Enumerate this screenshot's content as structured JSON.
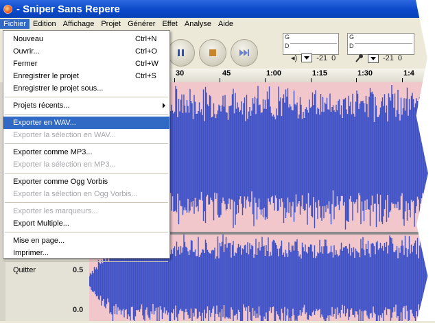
{
  "window": {
    "title": "- Sniper Sans Repere"
  },
  "menubar": [
    "Fichier",
    "Edition",
    "Affichage",
    "Projet",
    "Générer",
    "Effet",
    "Analyse",
    "Aide"
  ],
  "fichier_menu": {
    "nouveau": {
      "label": "Nouveau",
      "shortcut": "Ctrl+N"
    },
    "ouvrir": {
      "label": "Ouvrir...",
      "shortcut": "Ctrl+O"
    },
    "fermer": {
      "label": "Fermer",
      "shortcut": "Ctrl+W"
    },
    "enregistrer": {
      "label": "Enregistrer le projet",
      "shortcut": "Ctrl+S"
    },
    "enregistrer_sous": {
      "label": "Enregistrer le projet sous..."
    },
    "recents": {
      "label": "Projets récents..."
    },
    "exporter_wav": {
      "label": "Exporter en WAV..."
    },
    "exporter_sel_wav": {
      "label": "Exporter la sélection en WAV..."
    },
    "exporter_mp3": {
      "label": "Exporter comme MP3..."
    },
    "exporter_sel_mp3": {
      "label": "Exporter la sélection en MP3..."
    },
    "exporter_ogg": {
      "label": "Exporter comme Ogg Vorbis"
    },
    "exporter_sel_ogg": {
      "label": "Exporter la sélection en Ogg Vorbis..."
    },
    "exporter_marqueurs": {
      "label": "Exporter les marqueurs..."
    },
    "export_multiple": {
      "label": "Export Multiple..."
    },
    "mise_en_page": {
      "label": "Mise en page..."
    },
    "imprimer": {
      "label": "Imprimer..."
    },
    "quitter": {
      "label": "Quitter"
    }
  },
  "meters": {
    "output": {
      "g": "G",
      "d": "D",
      "level": "-21",
      "zero": "0"
    },
    "input": {
      "g": "G",
      "d": "D",
      "level": "-21",
      "zero": "0"
    }
  },
  "timeline": [
    "30",
    "45",
    "1:00",
    "1:15",
    "1:30",
    "1:4"
  ],
  "track_scale": {
    "upper": "0.5",
    "lower": "0.0"
  },
  "colors": {
    "waveform": "#3c50c8",
    "waveform_bg": "#f2c7cc",
    "highlight": "#316ac5",
    "titlebar": "#0a49c9"
  }
}
